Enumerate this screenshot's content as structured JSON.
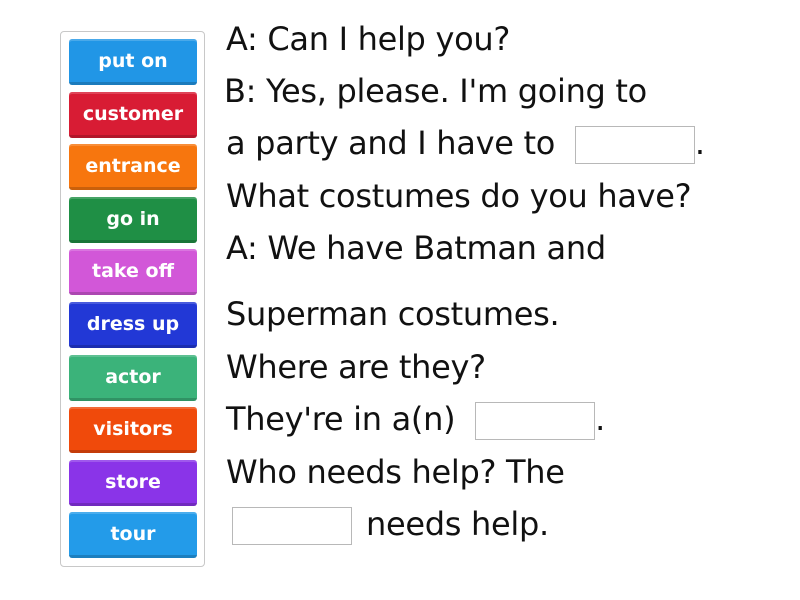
{
  "word_bank": [
    {
      "label": "put on",
      "color": "#2196e6"
    },
    {
      "label": "customer",
      "color": "#d81c34"
    },
    {
      "label": "entrance",
      "color": "#f7760e"
    },
    {
      "label": "go in",
      "color": "#1f8f45"
    },
    {
      "label": "take off",
      "color": "#d257d8"
    },
    {
      "label": "dress up",
      "color": "#2238d6"
    },
    {
      "label": "actor",
      "color": "#3bb37a"
    },
    {
      "label": "visitors",
      "color": "#f04a0b"
    },
    {
      "label": "store",
      "color": "#8a34e8"
    },
    {
      "label": "tour",
      "color": "#239be9"
    }
  ],
  "lines": [
    {
      "text": "A: Can I help you?"
    },
    {
      "text": "B: Yes, please. I'm going to"
    },
    {
      "before": "a party and I have to",
      "after": "."
    },
    {
      "text": "What costumes do you have?"
    },
    {
      "text": "A: We have Batman and"
    },
    {
      "text": "Superman costumes."
    },
    {
      "text": "Where are they?"
    },
    {
      "before": "They're in a(n)",
      "after": "."
    },
    {
      "text": "Who needs help? The"
    },
    {
      "after": "needs help."
    }
  ],
  "blanks": [
    {
      "value": ""
    },
    {
      "value": ""
    },
    {
      "value": ""
    }
  ]
}
